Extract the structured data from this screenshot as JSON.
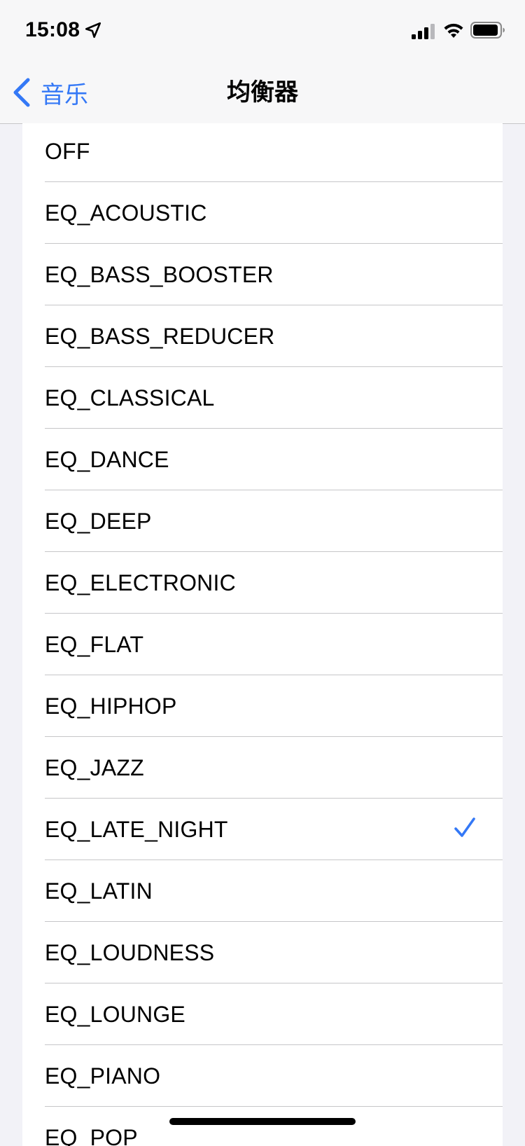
{
  "status_bar": {
    "time": "15:08",
    "icons": [
      "location-arrow-icon",
      "cellular-signal-icon",
      "wifi-icon",
      "battery-icon"
    ]
  },
  "nav": {
    "back_label": "音乐",
    "back_icon": "chevron-left-icon",
    "title": "均衡器"
  },
  "colors": {
    "accent": "#3478f6",
    "background": "#f2f2f7",
    "separator": "#c6c6c8"
  },
  "equalizer": {
    "selected": "EQ_LATE_NIGHT",
    "items": [
      {
        "label": "OFF"
      },
      {
        "label": "EQ_ACOUSTIC"
      },
      {
        "label": "EQ_BASS_BOOSTER"
      },
      {
        "label": "EQ_BASS_REDUCER"
      },
      {
        "label": "EQ_CLASSICAL"
      },
      {
        "label": "EQ_DANCE"
      },
      {
        "label": "EQ_DEEP"
      },
      {
        "label": "EQ_ELECTRONIC"
      },
      {
        "label": "EQ_FLAT"
      },
      {
        "label": "EQ_HIPHOP"
      },
      {
        "label": "EQ_JAZZ"
      },
      {
        "label": "EQ_LATE_NIGHT"
      },
      {
        "label": "EQ_LATIN"
      },
      {
        "label": "EQ_LOUDNESS"
      },
      {
        "label": "EQ_LOUNGE"
      },
      {
        "label": "EQ_PIANO"
      },
      {
        "label": "EQ_POP"
      }
    ]
  }
}
